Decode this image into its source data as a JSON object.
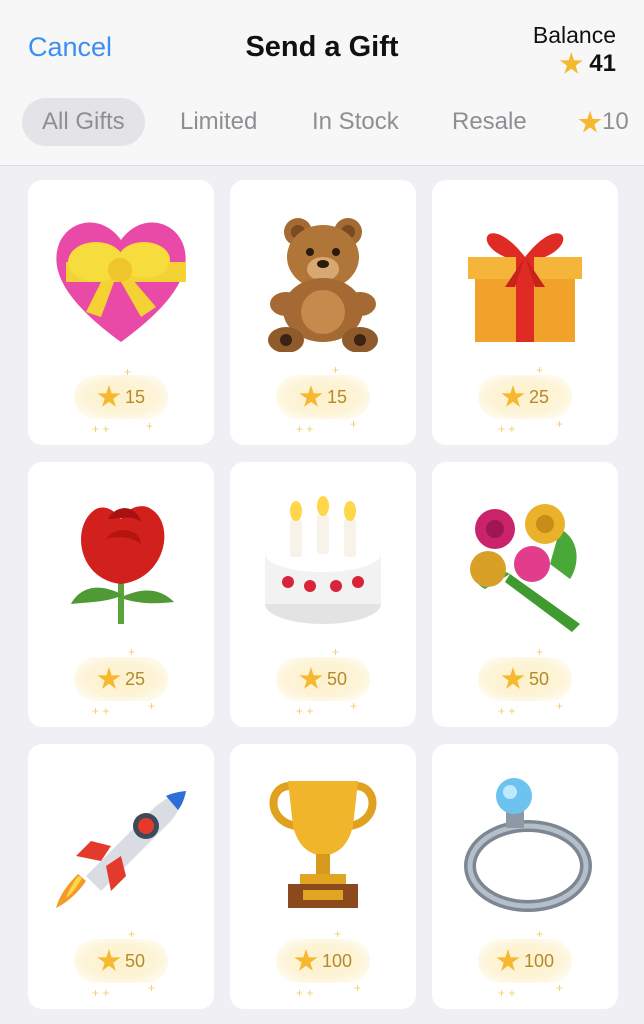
{
  "header": {
    "cancel_label": "Cancel",
    "title": "Send a Gift",
    "balance_label": "Balance",
    "balance_value": "41"
  },
  "tabs": [
    {
      "label": "All Gifts",
      "active": true
    },
    {
      "label": "Limited",
      "active": false
    },
    {
      "label": "In Stock",
      "active": false
    },
    {
      "label": "Resale",
      "active": false
    },
    {
      "label": "10",
      "active": false,
      "icon": "star-icon"
    }
  ],
  "gifts": [
    {
      "name": "heart-gift",
      "price": "15",
      "icon": "heart-with-ribbon-icon"
    },
    {
      "name": "teddy-bear-gift",
      "price": "15",
      "icon": "teddy-bear-icon"
    },
    {
      "name": "gift-box-gift",
      "price": "25",
      "icon": "gift-box-icon"
    },
    {
      "name": "rose-gift",
      "price": "25",
      "icon": "rose-icon"
    },
    {
      "name": "cake-gift",
      "price": "50",
      "icon": "birthday-cake-icon"
    },
    {
      "name": "bouquet-gift",
      "price": "50",
      "icon": "bouquet-icon"
    },
    {
      "name": "rocket-gift",
      "price": "50",
      "icon": "rocket-icon"
    },
    {
      "name": "trophy-gift",
      "price": "100",
      "icon": "trophy-icon"
    },
    {
      "name": "ring-gift",
      "price": "100",
      "icon": "ring-icon"
    }
  ],
  "colors": {
    "accent": "#3c8ff0",
    "star": "#f5b82e",
    "price_text": "#b58a2a"
  }
}
